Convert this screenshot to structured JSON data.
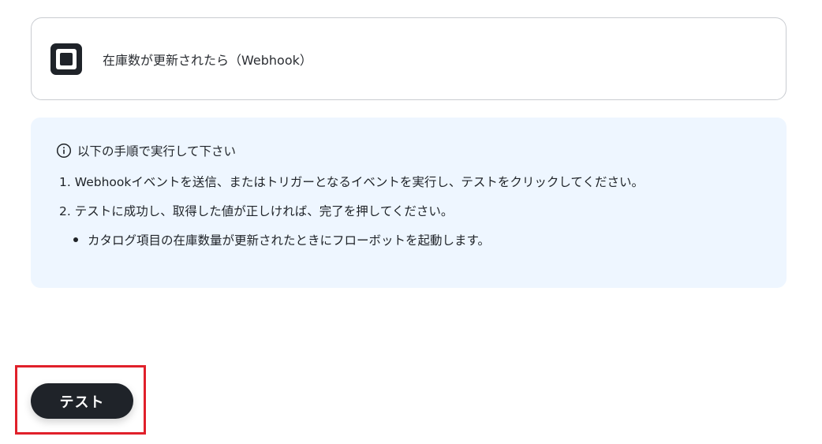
{
  "trigger": {
    "app_icon": "square-logo-icon",
    "label": "在庫数が更新されたら（Webhook）"
  },
  "instructions": {
    "icon": "info-circle-icon",
    "heading": "以下の手順で実行して下さい",
    "steps": [
      {
        "num": "1.",
        "text": "Webhookイベントを送信、またはトリガーとなるイベントを実行し、テストをクリックしてください。"
      },
      {
        "num": "2.",
        "text": "テストに成功し、取得した値が正しければ、完了を押してください。"
      }
    ],
    "notes": [
      "カタログ項目の在庫数量が更新されたときにフローボットを起動します。"
    ]
  },
  "actions": {
    "test_label": "テスト"
  },
  "colors": {
    "info_bg": "#eef6ff",
    "button_bg": "#1f2329",
    "highlight": "#e0202a"
  }
}
